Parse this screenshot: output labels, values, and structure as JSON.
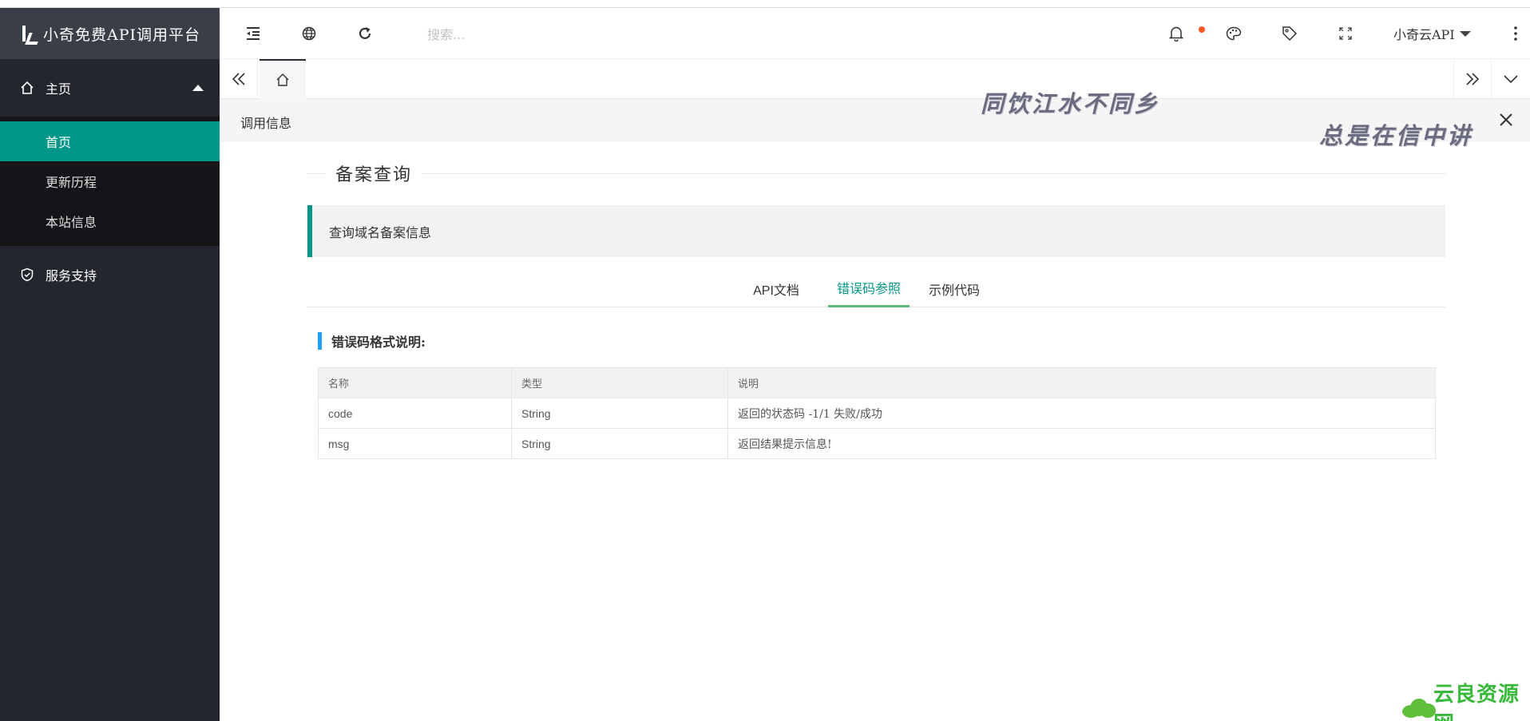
{
  "app": {
    "title": "小奇免费API调用平台"
  },
  "sidebar": {
    "groups": [
      {
        "label": "主页",
        "icon": "home-icon",
        "expanded": true,
        "items": [
          {
            "label": "首页",
            "active": true
          },
          {
            "label": "更新历程",
            "active": false
          },
          {
            "label": "本站信息",
            "active": false
          }
        ]
      },
      {
        "label": "服务支持",
        "icon": "shield-check-icon",
        "expanded": false
      }
    ]
  },
  "header": {
    "search_placeholder": "搜索...",
    "user_name": "小奇云API",
    "icons": [
      "flex-menu-icon",
      "globe-icon",
      "refresh-icon",
      "bell-icon",
      "palette-icon",
      "tag-icon",
      "fullscreen-icon",
      "more-vertical-icon"
    ]
  },
  "tabsbar": {
    "home_tab_icon": "home-icon"
  },
  "content": {
    "breadcrumb": "调用信息",
    "watermark_line1": "同饮江水不同乡",
    "watermark_line2": "总是在信中讲",
    "legend": "备案查询",
    "description": "查询域名备案信息",
    "tabs": [
      {
        "label": "API文档",
        "active": false
      },
      {
        "label": "错误码参照",
        "active": true
      },
      {
        "label": "示例代码",
        "active": false
      }
    ],
    "section_title": "错误码格式说明:",
    "table": {
      "headers": [
        "名称",
        "类型",
        "说明"
      ],
      "rows": [
        [
          "code",
          "String",
          "返回的状态码 -1/1 失败/成功"
        ],
        [
          "msg",
          "String",
          "返回结果提示信息!"
        ]
      ]
    }
  },
  "corner_logo": {
    "text": "云良资源网"
  },
  "colors": {
    "sidebar_bg": "#23262e",
    "accent": "#009688",
    "tab_underline": "#5FB878",
    "section_bar": "#1E9FFF",
    "badge": "#ff5722"
  }
}
